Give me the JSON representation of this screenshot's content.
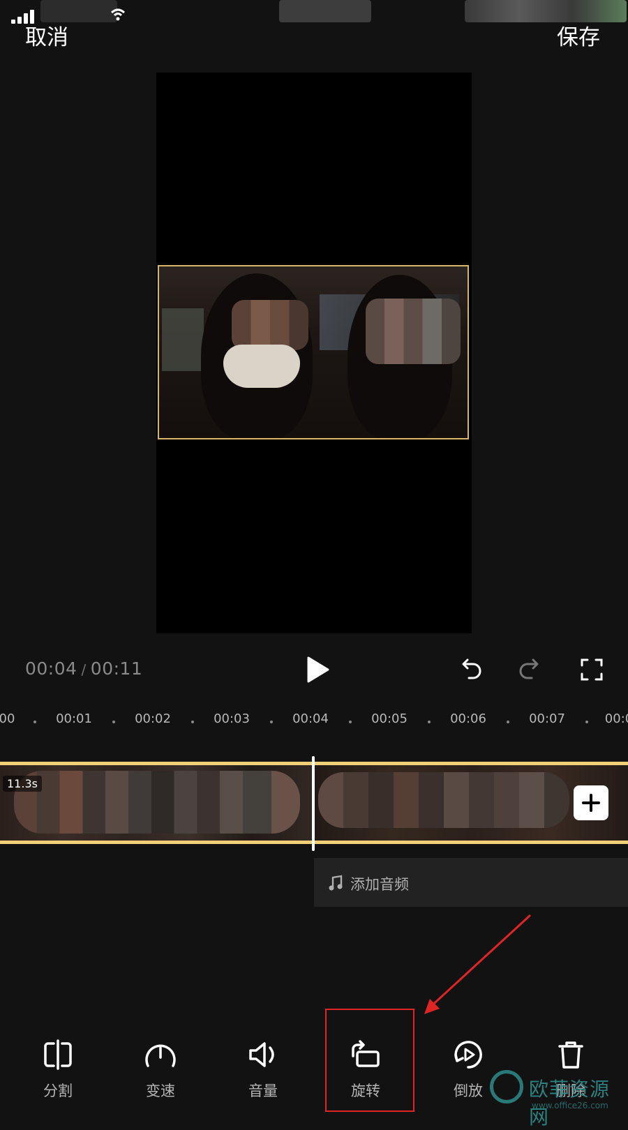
{
  "header": {
    "cancel_label": "取消",
    "save_label": "保存"
  },
  "playback": {
    "current_time": "00:04",
    "separator": "/",
    "total_time": "00:11"
  },
  "ruler": {
    "ticks": [
      "00",
      "00:01",
      "00:02",
      "00:03",
      "00:04",
      "00:05",
      "00:06",
      "00:07",
      "00:0"
    ]
  },
  "timeline": {
    "clip_duration": "11.3s",
    "add_audio_label": "添加音频"
  },
  "toolbar": {
    "items": [
      {
        "label": "分割",
        "icon": "split-icon"
      },
      {
        "label": "变速",
        "icon": "speed-gauge-icon"
      },
      {
        "label": "音量",
        "icon": "volume-icon"
      },
      {
        "label": "旋转",
        "icon": "rotate-icon"
      },
      {
        "label": "倒放",
        "icon": "reverse-play-icon"
      },
      {
        "label": "删除",
        "icon": "trash-icon"
      }
    ]
  },
  "watermark": {
    "text": "欧菲资源网",
    "sub": "www.office26.com"
  },
  "colors": {
    "background": "#121212",
    "accent_gold": "#f1d177",
    "frame_border": "#d8b566",
    "highlight_red": "#e02424"
  }
}
